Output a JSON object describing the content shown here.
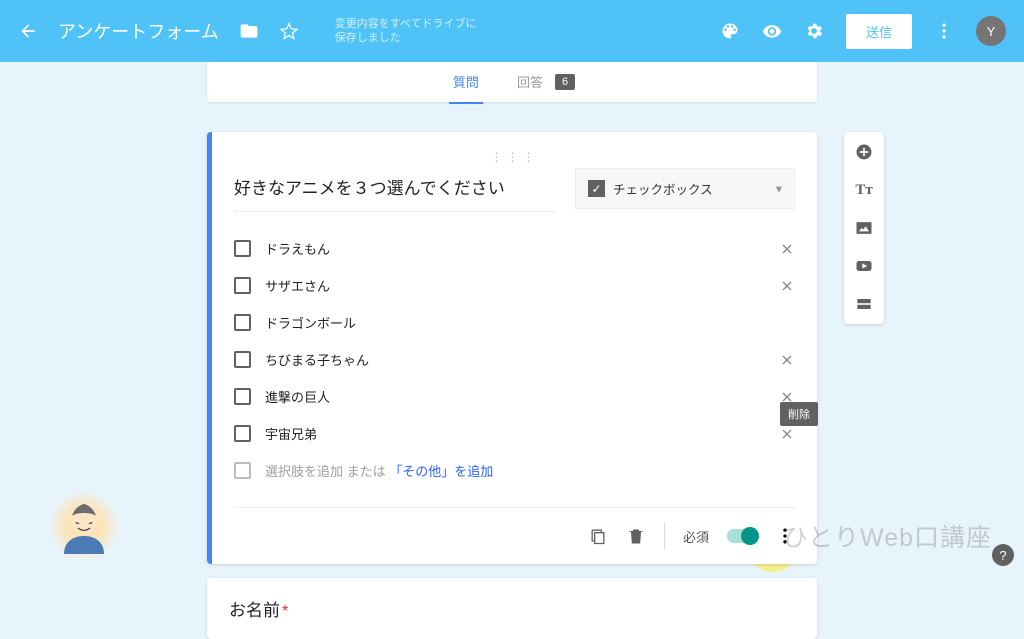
{
  "header": {
    "title": "アンケートフォーム",
    "save_msg_l1": "変更内容をすべてドライブに",
    "save_msg_l2": "保存しました",
    "send_label": "送信",
    "avatar_initial": "Y"
  },
  "tabs": {
    "questions": "質問",
    "responses": "回答",
    "response_count": "6"
  },
  "question": {
    "title": "好きなアニメを３つ選んでください",
    "type_label": "チェックボックス",
    "options": [
      "ドラえもん",
      "サザエさん",
      "ドラゴンボール",
      "ちびまる子ちゃん",
      "進撃の巨人",
      "宇宙兄弟"
    ],
    "add_option_text": "選択肢を追加",
    "add_or": "または",
    "add_other": "「その他」を追加",
    "tooltip_delete": "削除",
    "required_label": "必須"
  },
  "next_question": {
    "title": "お名前"
  },
  "watermark": "ひとりWeb口講座"
}
